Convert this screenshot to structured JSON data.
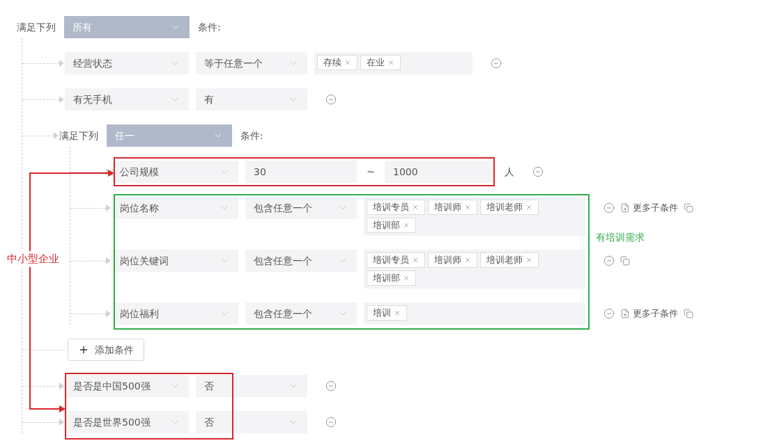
{
  "root": {
    "label": "满足下列",
    "mode": "所有",
    "suffix": "条件:",
    "conditions": [
      {
        "kind": "tags",
        "field": "经营状态",
        "operator": "等于任意一个",
        "tags": [
          "存续",
          "在业"
        ],
        "actions": [
          {
            "kind": "remove"
          }
        ]
      },
      {
        "kind": "select",
        "field": "有无手机",
        "operator": "有",
        "actions": [
          {
            "kind": "remove"
          }
        ]
      },
      {
        "kind": "group",
        "label": "满足下列",
        "mode": "任一",
        "suffix": "条件:",
        "conditions": [
          {
            "kind": "range",
            "field": "公司规模",
            "from": "30",
            "separator": "~",
            "to": "1000",
            "unit": "人",
            "actions": [
              {
                "kind": "remove"
              }
            ]
          },
          {
            "kind": "tags",
            "field": "岗位名称",
            "operator": "包含任意一个",
            "tags": [
              "培训专员",
              "培训师",
              "培训老师",
              "培训部"
            ],
            "actions": [
              {
                "kind": "remove"
              },
              {
                "kind": "more",
                "label": "更多子条件"
              },
              {
                "kind": "copy"
              }
            ]
          },
          {
            "kind": "tags",
            "field": "岗位关键词",
            "operator": "包含任意一个",
            "tags": [
              "培训专员",
              "培训师",
              "培训老师",
              "培训部"
            ],
            "actions": [
              {
                "kind": "remove"
              },
              {
                "kind": "copy"
              }
            ]
          },
          {
            "kind": "tags",
            "field": "岗位福利",
            "operator": "包含任意一个",
            "tags": [
              "培训"
            ],
            "actions": [
              {
                "kind": "remove"
              },
              {
                "kind": "more",
                "label": "更多子条件"
              },
              {
                "kind": "copy"
              }
            ]
          }
        ]
      },
      {
        "kind": "add",
        "label": "添加条件"
      },
      {
        "kind": "select",
        "field": "是否是中国500强",
        "operator": "否",
        "actions": [
          {
            "kind": "remove"
          }
        ]
      },
      {
        "kind": "select",
        "field": "是否是世界500强",
        "operator": "否",
        "actions": [
          {
            "kind": "remove"
          }
        ]
      }
    ]
  },
  "annotations": {
    "small_business": {
      "label": "中小型企业"
    },
    "training": {
      "label": "有培训需求"
    }
  }
}
